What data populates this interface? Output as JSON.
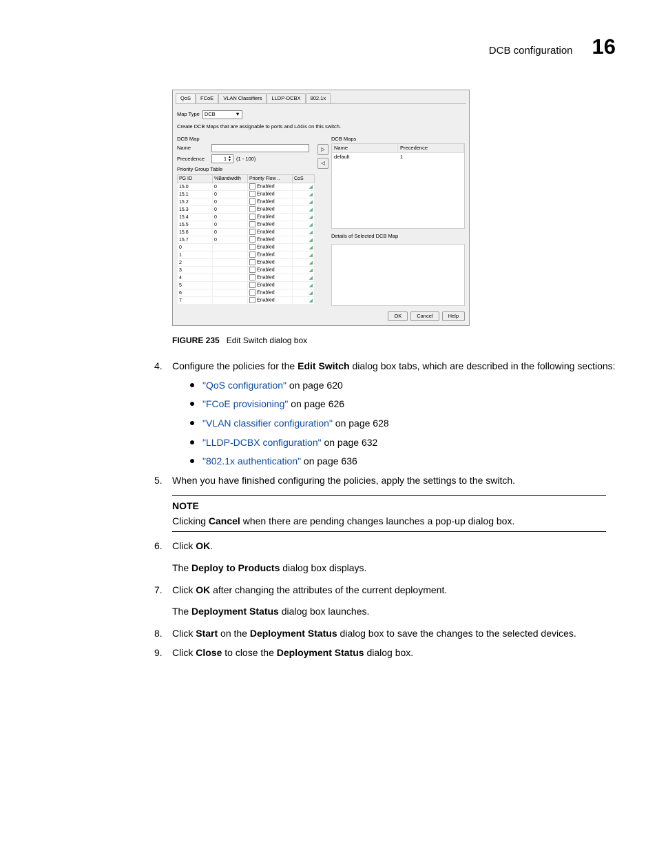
{
  "header": {
    "section": "DCB configuration",
    "chapter": "16"
  },
  "dialog": {
    "tabs": [
      "QoS",
      "FCoE",
      "VLAN Classifiers",
      "LLDP-DCBX",
      "802.1x"
    ],
    "map_type_label": "Map Type",
    "map_type_value": "DCB",
    "description": "Create DCB Maps that are assignable to ports and LAGs on this switch.",
    "dcb_map_title": "DCB Map",
    "name_label": "Name",
    "precedence_label": "Precedence",
    "precedence_value": "1",
    "precedence_range": "(1 - 100)",
    "pg_table_title": "Priority Group Table",
    "pg_headers": [
      "PG ID",
      "%Bandwidth",
      "Priority Flow ..",
      "CoS"
    ],
    "pg_rows": [
      {
        "id": "15.0",
        "bw": "0",
        "pf": "Enabled"
      },
      {
        "id": "15.1",
        "bw": "0",
        "pf": "Enabled"
      },
      {
        "id": "15.2",
        "bw": "0",
        "pf": "Enabled"
      },
      {
        "id": "15.3",
        "bw": "0",
        "pf": "Enabled"
      },
      {
        "id": "15.4",
        "bw": "0",
        "pf": "Enabled"
      },
      {
        "id": "15.5",
        "bw": "0",
        "pf": "Enabled"
      },
      {
        "id": "15.6",
        "bw": "0",
        "pf": "Enabled"
      },
      {
        "id": "15.7",
        "bw": "0",
        "pf": "Enabled"
      },
      {
        "id": "0",
        "bw": "",
        "pf": "Enabled"
      },
      {
        "id": "1",
        "bw": "",
        "pf": "Enabled"
      },
      {
        "id": "2",
        "bw": "",
        "pf": "Enabled"
      },
      {
        "id": "3",
        "bw": "",
        "pf": "Enabled"
      },
      {
        "id": "4",
        "bw": "",
        "pf": "Enabled"
      },
      {
        "id": "5",
        "bw": "",
        "pf": "Enabled"
      },
      {
        "id": "6",
        "bw": "",
        "pf": "Enabled"
      },
      {
        "id": "7",
        "bw": "",
        "pf": "Enabled"
      }
    ],
    "maps_title": "DCB Maps",
    "maps_headers": [
      "Name",
      "Precedence"
    ],
    "maps_rows": [
      {
        "name": "default",
        "prec": "1"
      }
    ],
    "details_title": "Details of Selected DCB Map",
    "buttons": {
      "ok": "OK",
      "cancel": "Cancel",
      "help": "Help"
    }
  },
  "figure": {
    "number": "FIGURE 235",
    "caption": "Edit Switch dialog box"
  },
  "steps": {
    "s4_pre": "Configure the policies for the ",
    "s4_bold": "Edit Switch",
    "s4_post": " dialog box tabs, which are described in the following sections:",
    "bullets": [
      {
        "link": "\"QoS configuration\"",
        "tail": " on page 620"
      },
      {
        "link": "\"FCoE provisioning\"",
        "tail": " on page 626"
      },
      {
        "link": "\"VLAN classifier configuration\"",
        "tail": " on page 628"
      },
      {
        "link": "\"LLDP-DCBX configuration\"",
        "tail": " on page 632"
      },
      {
        "link": "\"802.1x authentication\"",
        "tail": " on page 636"
      }
    ],
    "s5": "When you have finished configuring the policies, apply the settings to the switch.",
    "note_title": "NOTE",
    "note_pre": "Clicking ",
    "note_bold": "Cancel",
    "note_post": " when there are pending changes launches a pop-up dialog box.",
    "s6_pre": "Click ",
    "s6_bold": "OK",
    "s6_post": ".",
    "s6_para_pre": "The ",
    "s6_para_bold": "Deploy to Products",
    "s6_para_post": " dialog box displays.",
    "s7_pre": "Click ",
    "s7_bold": "OK",
    "s7_post": " after changing the attributes of the current deployment.",
    "s7_para_pre": "The ",
    "s7_para_bold": "Deployment Status",
    "s7_para_post": " dialog box launches.",
    "s8_pre": "Click ",
    "s8_bold1": "Start",
    "s8_mid": " on the ",
    "s8_bold2": "Deployment Status",
    "s8_post": " dialog box to save the changes to the selected devices.",
    "s9_pre": "Click ",
    "s9_bold1": "Close",
    "s9_mid": " to close the ",
    "s9_bold2": "Deployment Status",
    "s9_post": " dialog box."
  }
}
